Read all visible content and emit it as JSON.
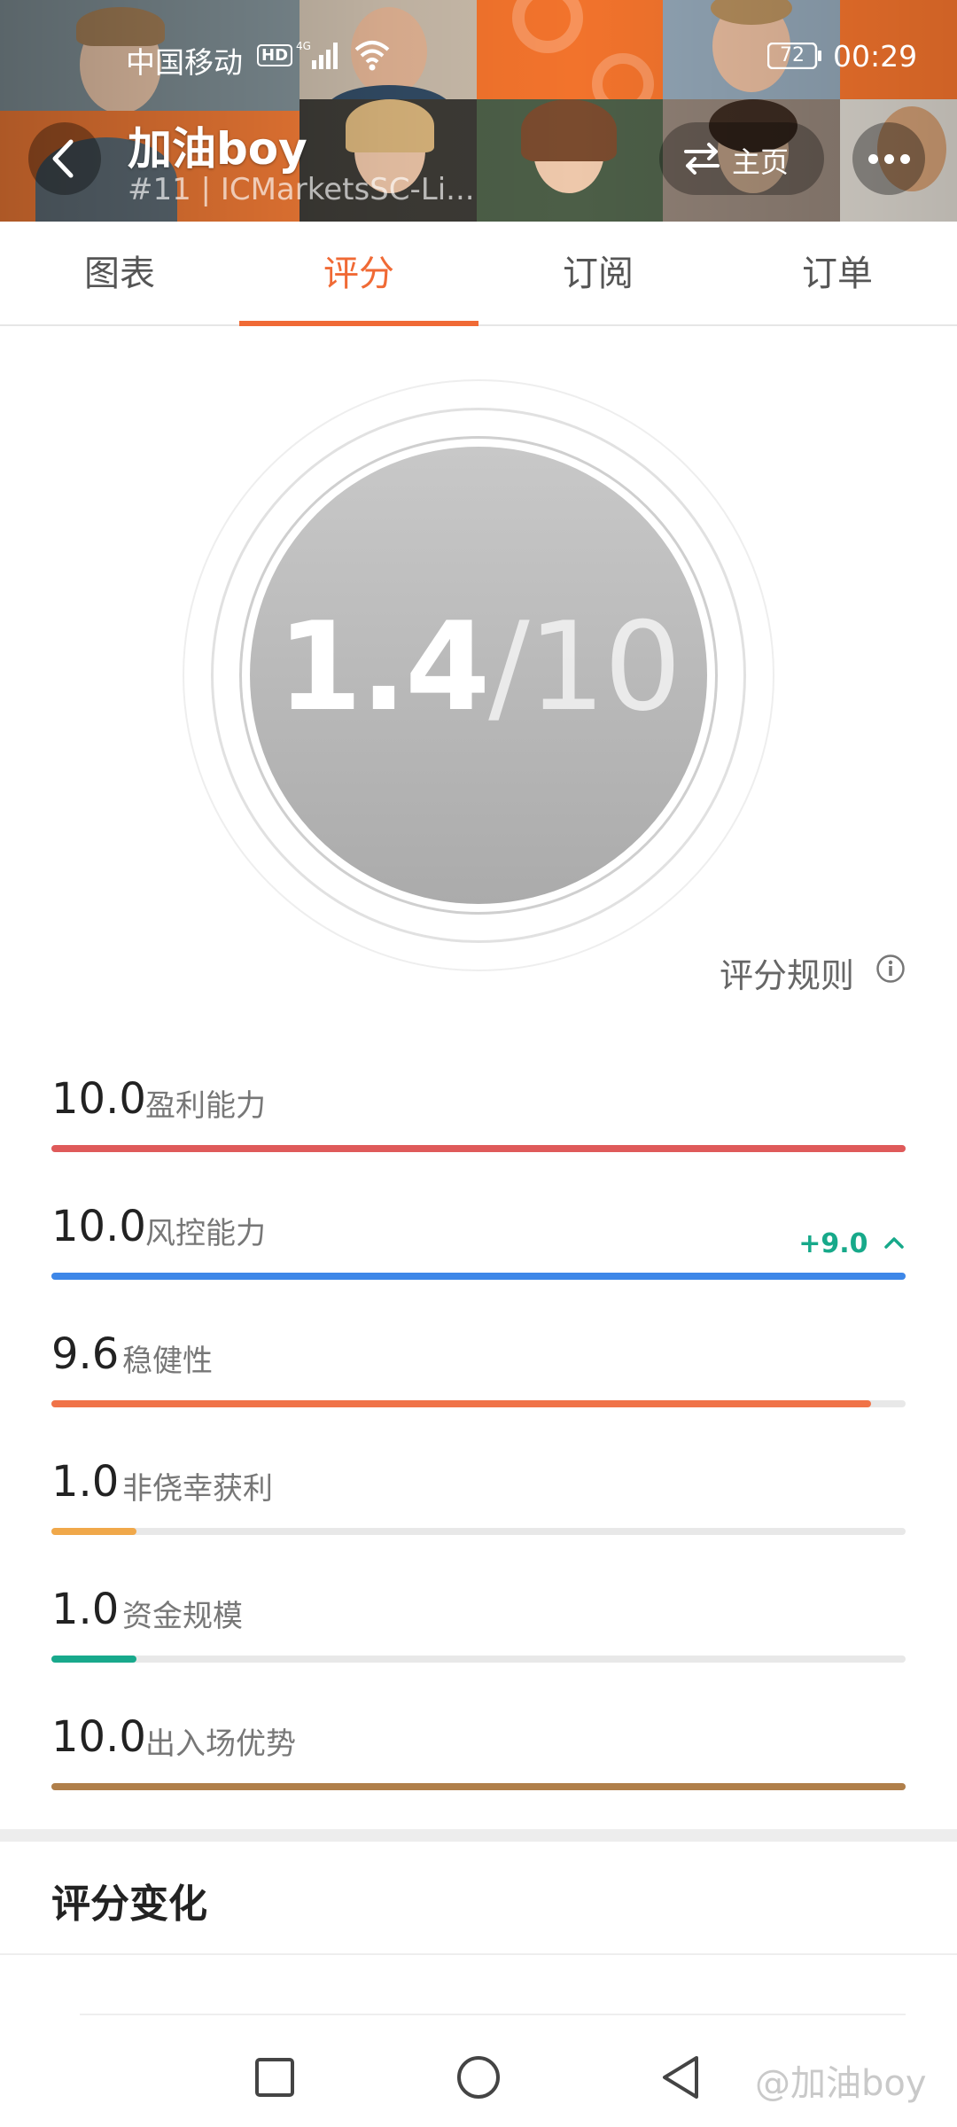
{
  "status_bar": {
    "carrier": "中国移动",
    "hd": "HD",
    "network": "4G",
    "battery": "72",
    "time": "00:29"
  },
  "header": {
    "name": "加油boy",
    "subtitle": "#11 | ICMarketsSC-Li...",
    "home_label": "主页"
  },
  "tabs": [
    {
      "label": "图表",
      "active": false
    },
    {
      "label": "评分",
      "active": true
    },
    {
      "label": "订阅",
      "active": false
    },
    {
      "label": "订单",
      "active": false
    }
  ],
  "score": {
    "value": "1.4",
    "max": "/10",
    "rules_label": "评分规则"
  },
  "metrics": [
    {
      "value": "10.0",
      "label": "盈利能力",
      "fraction": 1.0,
      "color": "#df5a5a"
    },
    {
      "value": "10.0",
      "label": "风控能力",
      "fraction": 1.0,
      "color": "#3e87e8",
      "change": "+9.0"
    },
    {
      "value": "9.6",
      "label": "稳健性",
      "fraction": 0.96,
      "color": "#f07348"
    },
    {
      "value": "1.0",
      "label": "非侥幸获利",
      "fraction": 0.1,
      "color": "#f0a84a"
    },
    {
      "value": "1.0",
      "label": "资金规模",
      "fraction": 0.1,
      "color": "#18a98c"
    },
    {
      "value": "10.0",
      "label": "出入场优势",
      "fraction": 1.0,
      "color": "#b07f4a"
    }
  ],
  "section": {
    "title": "评分变化"
  },
  "watermark": "@加油boy"
}
